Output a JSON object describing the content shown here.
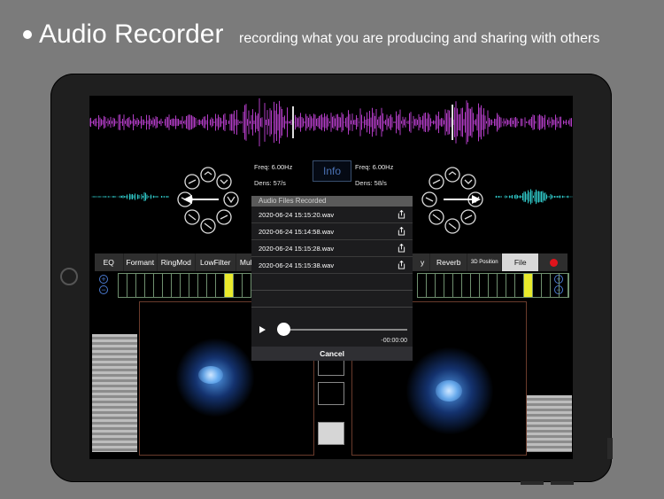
{
  "headline": {
    "title": "Audio Recorder",
    "subtitle": "recording what you are producing and sharing with others"
  },
  "left_deck": {
    "freq": "Freq: 6.00Hz",
    "dens": "Dens: 57/s"
  },
  "right_deck": {
    "freq": "Freq: 6.00Hz",
    "dens": "Dens: 58/s"
  },
  "info_label": "Info",
  "toolbar": {
    "left_items": [
      "EQ",
      "Formant",
      "RingMod",
      "LowFilter",
      "Mul"
    ],
    "right_items": [
      "y",
      "Reverb",
      "3D Position"
    ],
    "file_label": "File"
  },
  "dialog": {
    "title": "Audio Files Recorded",
    "files": [
      "2020-06-24 15:15:20.wav",
      "2020-06-24 15:14:58.wav",
      "2020-06-24 15:15:28.wav",
      "2020-06-24 15:15:38.wav"
    ],
    "time": "-00:00:00",
    "cancel": "Cancel",
    "progress": 0
  },
  "colors": {
    "waveform": "#b13cc4",
    "mini_wave": "#2fc7c7",
    "meter_on": "#e9ea2b",
    "record": "#e0141c",
    "info": "#4b72b5"
  },
  "icons": [
    "play-icon",
    "share-icon",
    "plus-icon",
    "minus-icon",
    "record-icon"
  ]
}
